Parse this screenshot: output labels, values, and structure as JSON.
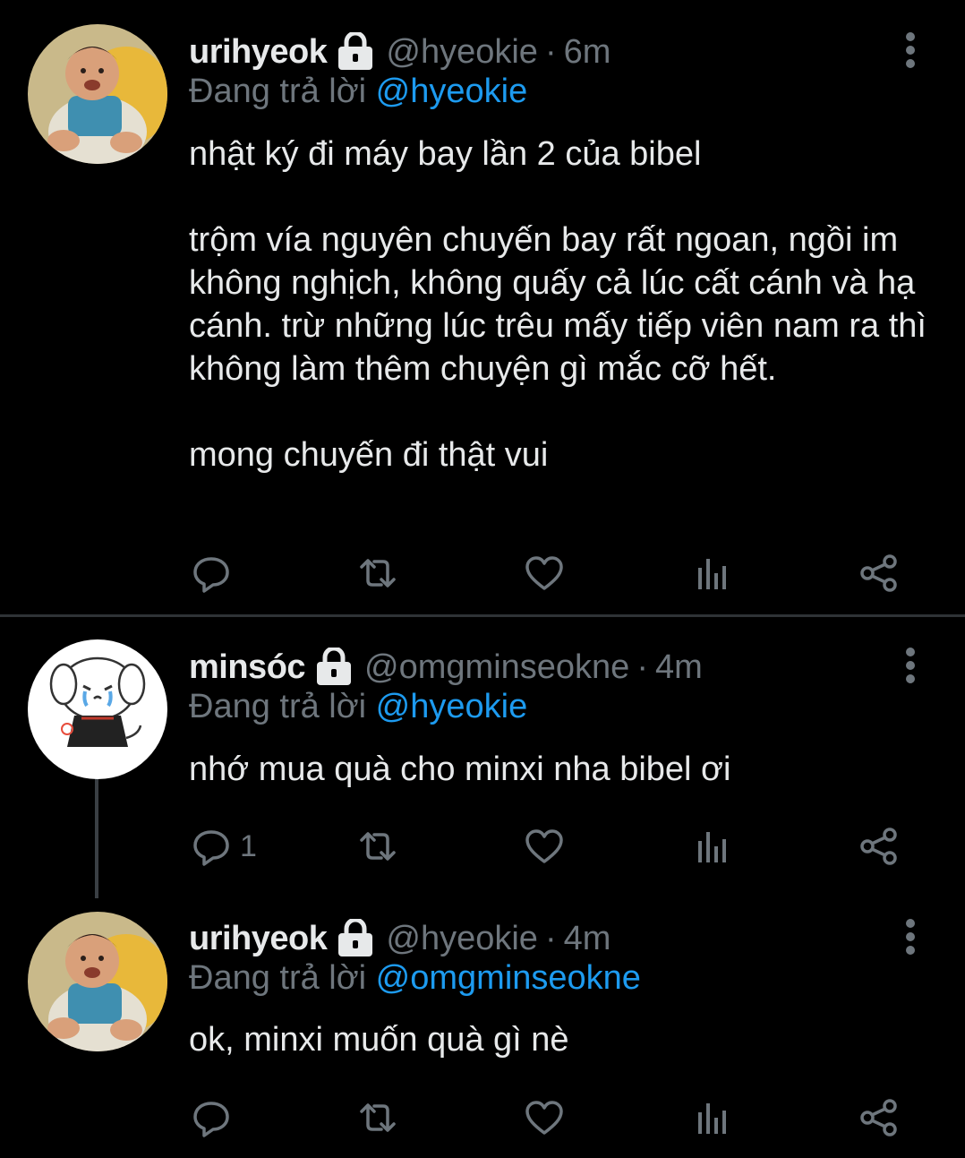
{
  "tweets": [
    {
      "name": "urihyeok",
      "handle": "@hyeokie",
      "dot": "·",
      "time": "6m",
      "reply_prefix": "Đang trả lời",
      "reply_to": "@hyeokie",
      "paragraphs": [
        "nhật ký đi máy bay lần 2 của bibel",
        "trộm vía nguyên chuyến bay rất ngoan, ngồi im không nghịch, không quấy cả lúc cất cánh và hạ cánh. trừ những lúc trêu mấy tiếp viên nam ra thì không làm thêm chuyện gì mắc cỡ hết.",
        "mong chuyến đi thật vui"
      ],
      "reply_count": ""
    },
    {
      "name": "minsóc",
      "handle": "@omgminseokne",
      "dot": "·",
      "time": "4m",
      "reply_prefix": "Đang trả lời",
      "reply_to": "@hyeokie",
      "paragraphs": [
        "nhớ mua quà cho minxi nha bibel ơi"
      ],
      "reply_count": "1"
    },
    {
      "name": "urihyeok",
      "handle": "@hyeokie",
      "dot": "·",
      "time": "4m",
      "reply_prefix": "Đang trả lời",
      "reply_to": "@omgminseokne",
      "paragraphs": [
        "ok, minxi muốn quà gì nè"
      ],
      "reply_count": ""
    }
  ],
  "icons": {
    "lock": "lock-icon",
    "more": "more-vertical-icon",
    "reply": "reply-icon",
    "retweet": "retweet-icon",
    "like": "heart-icon",
    "analytics": "analytics-icon",
    "share": "share-icon"
  },
  "colors": {
    "background": "#000000",
    "text": "#e7e9ea",
    "muted": "#6e767d",
    "link": "#1d9bf0",
    "divider": "#2f3336"
  }
}
